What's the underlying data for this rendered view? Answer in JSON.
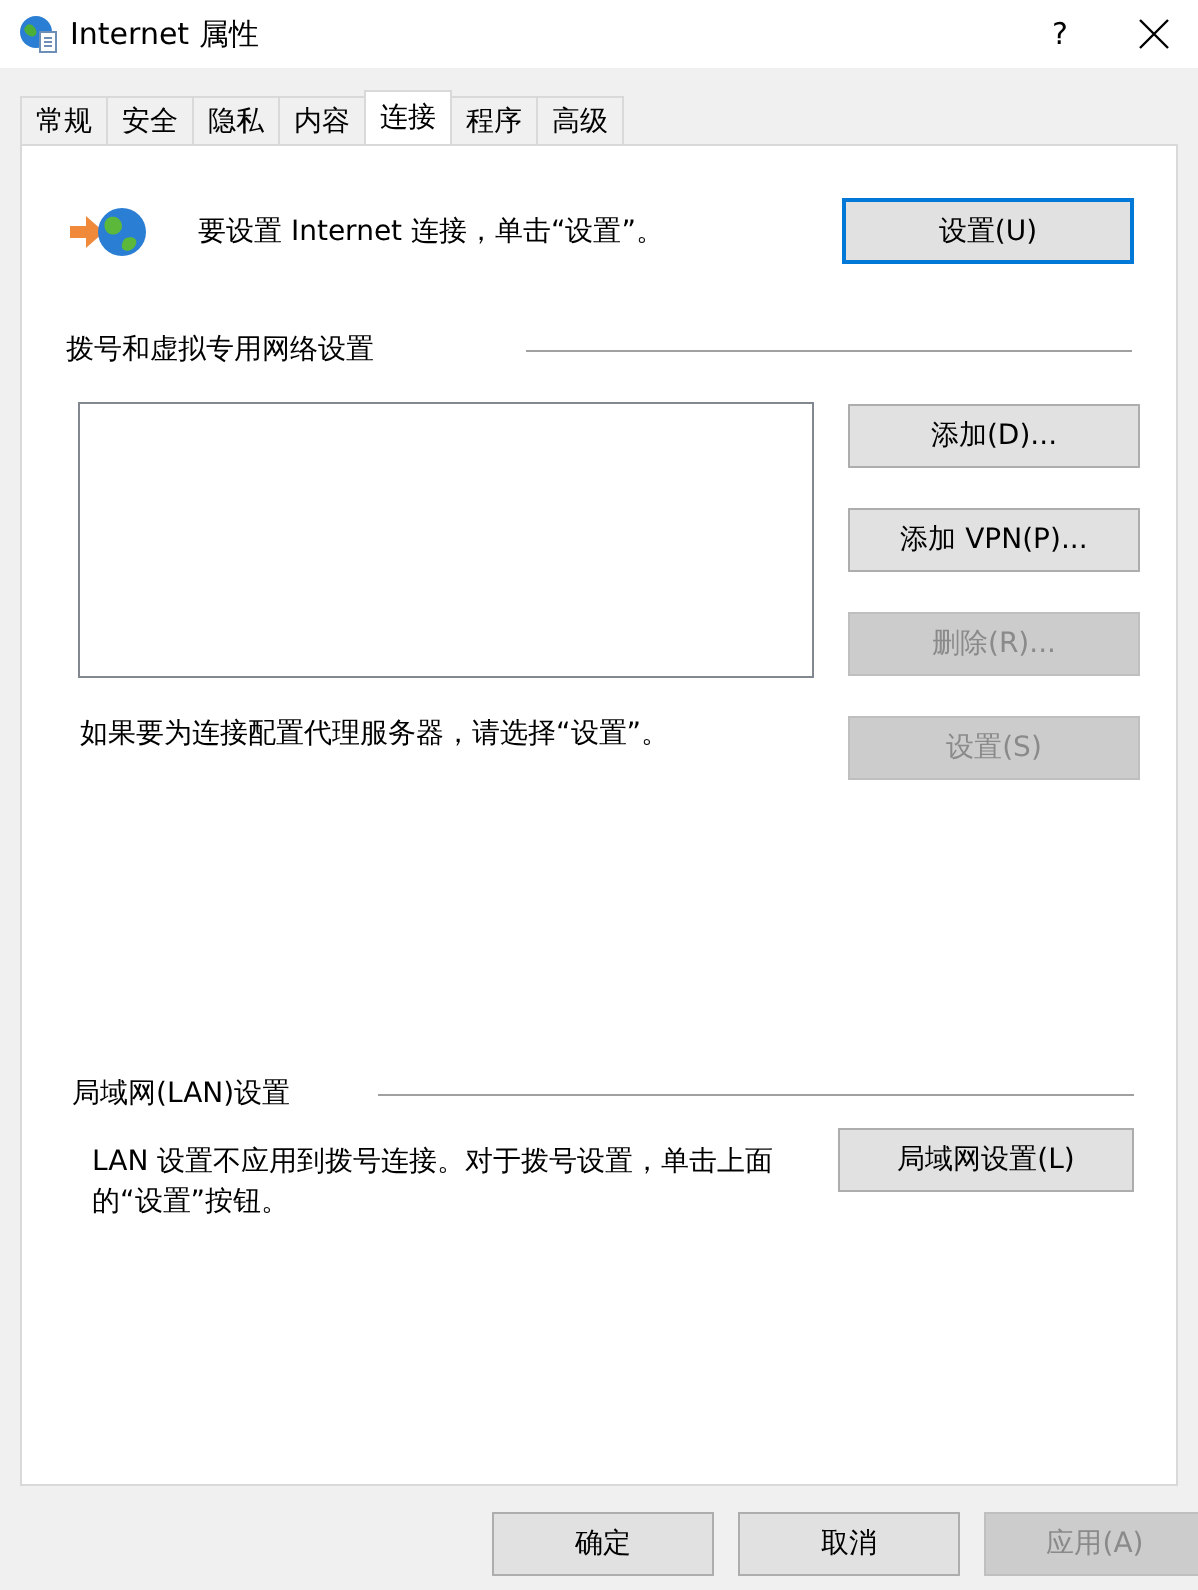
{
  "window": {
    "title": "Internet 属性",
    "help": "?"
  },
  "tabs": [
    {
      "label": "常规",
      "selected": false
    },
    {
      "label": "安全",
      "selected": false
    },
    {
      "label": "隐私",
      "selected": false
    },
    {
      "label": "内容",
      "selected": false
    },
    {
      "label": "连接",
      "selected": true
    },
    {
      "label": "程序",
      "selected": false
    },
    {
      "label": "高级",
      "selected": false
    }
  ],
  "connection": {
    "text": "要设置 Internet 连接，单击“设置”。",
    "button": {
      "label": "设置(U)",
      "focused": true
    }
  },
  "dialup": {
    "heading": "拨号和虚拟专用网络设置",
    "buttons": [
      {
        "label": "添加(D)...",
        "disabled": false
      },
      {
        "label": "添加 VPN(P)...",
        "disabled": false
      },
      {
        "label": "删除(R)...",
        "disabled": true
      }
    ],
    "proxy_text": "如果要为连接配置代理服务器，请选择“设置”。",
    "proxy_button": {
      "label": "设置(S)",
      "disabled": true
    }
  },
  "lan": {
    "heading": "局域网(LAN)设置",
    "text": "LAN 设置不应用到拨号连接。对于拨号设置，单击上面的“设置”按钮。",
    "button": {
      "label": "局域网设置(L)",
      "disabled": false
    }
  },
  "footer_buttons": [
    {
      "label": "确定",
      "disabled": false
    },
    {
      "label": "取消",
      "disabled": false
    },
    {
      "label": "应用(A)",
      "disabled": true
    }
  ]
}
